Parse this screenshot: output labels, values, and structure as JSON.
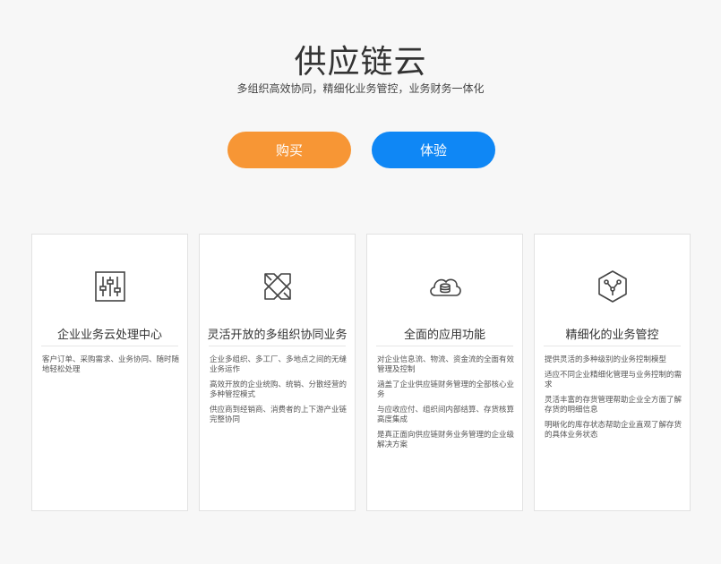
{
  "header": {
    "title": "供应链云",
    "subtitle": "多组织高效协同，精细化业务管控，业务财务一体化"
  },
  "actions": {
    "buy_label": "购买",
    "try_label": "体验",
    "buy_color": "#f79635",
    "try_color": "#0f87f5"
  },
  "cards": [
    {
      "icon": "sliders-icon",
      "title": "企业业务云处理中心",
      "items": [
        "客户订单、采购需求、业务协同、随时随地轻松处理"
      ]
    },
    {
      "icon": "cross-arrows-icon",
      "title": "灵活开放的多组织协同业务",
      "items": [
        "企业多组织、多工厂、多地点之间的无缝业务运作",
        "高效开放的企业统购、统销、分散经营的多种管控模式",
        "供应商到经销商、消费者的上下游产业链完整协同"
      ]
    },
    {
      "icon": "cloud-database-icon",
      "title": "全面的应用功能",
      "items": [
        "对企业信息流、物流、资金流的全面有效管理及控制",
        "涵盖了企业供应链财务管理的全部核心业务",
        "与应收应付、组织间内部结算、存货核算高度集成",
        "是真正面向供应链财务业务管理的企业级解决方案"
      ]
    },
    {
      "icon": "hexagon-network-icon",
      "title": "精细化的业务管控",
      "items": [
        "提供灵活的多种级别的业务控制模型",
        "适应不同企业精细化管理与业务控制的需求",
        "灵活丰富的存货管理帮助企业全方面了解存货的明细信息",
        "明晰化的库存状态帮助企业直观了解存货的具体业务状态"
      ]
    }
  ]
}
